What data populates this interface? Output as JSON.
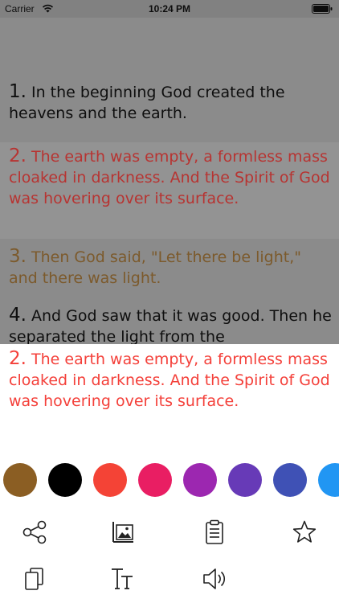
{
  "status_bar": {
    "carrier": "Carrier",
    "time": "10:24 PM"
  },
  "reader": {
    "verses": [
      {
        "number": "1.",
        "text": "In the beginning God created the heavens and the earth.",
        "color": "#0e0e0e"
      },
      {
        "number": "2.",
        "text": "The earth was empty, a formless mass cloaked in darkness. And the Spirit of God was hovering over its surface.",
        "color": "#b73432",
        "selected": true
      },
      {
        "number": "3.",
        "text": "Then God said, \"Let there be light,\" and there was light.",
        "color": "#7c5a2c"
      },
      {
        "number": "4.",
        "text": "And God saw that it was good. Then he separated the light from the",
        "color": "#0e0e0e"
      }
    ]
  },
  "highlight_sheet": {
    "preview": {
      "number": "2.",
      "text": "The earth was empty, a formless mass cloaked in darkness. And the Spirit of God was hovering over its surface."
    },
    "colors": [
      "#8b5e23",
      "#000000",
      "#f44336",
      "#e91e63",
      "#9c27b0",
      "#673ab7",
      "#3f51b5",
      "#2196f3"
    ],
    "actions_row1": [
      "share-icon",
      "image-icon",
      "clipboard-icon",
      "star-icon"
    ],
    "actions_row2": [
      "copy-icon",
      "text-size-icon",
      "speaker-icon"
    ]
  }
}
